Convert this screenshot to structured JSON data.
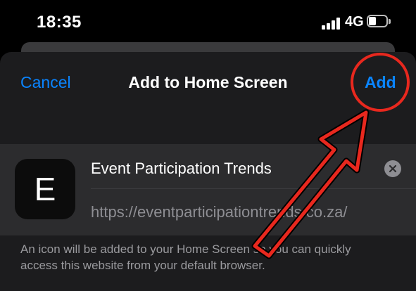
{
  "status_bar": {
    "time": "18:35",
    "network": "4G",
    "signal_bars": 4,
    "battery_level": 0.4
  },
  "nav": {
    "cancel_label": "Cancel",
    "title": "Add to Home Screen",
    "add_label": "Add"
  },
  "app": {
    "icon_letter": "E",
    "name": "Event Participation Trends",
    "url": "https://eventparticipationtrends.co.za/"
  },
  "info": {
    "text": "An icon will be added to your Home Screen so you can quickly access this website from your default browser."
  },
  "colors": {
    "accent": "#0a84ff",
    "annotation": "#e8281e",
    "sheet_bg": "#1c1c1e",
    "card_bg": "#2c2c2e"
  },
  "icons": [
    "signal-icon",
    "battery-icon",
    "clear-icon",
    "annotation-arrow-icon",
    "annotation-circle-icon"
  ]
}
